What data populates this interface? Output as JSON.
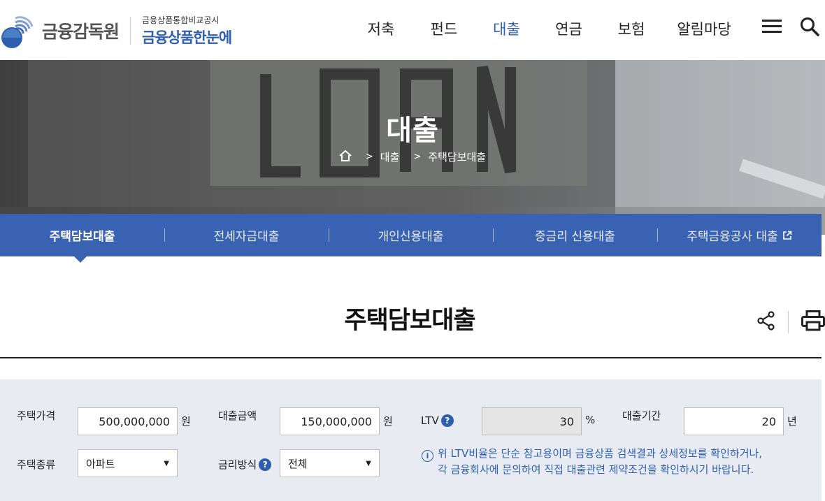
{
  "header": {
    "logo_text": "금융감독원",
    "logo_sub_small": "금융상품통합비교공시",
    "logo_sub_big": "금융상품한눈에",
    "nav": [
      {
        "label": "저축"
      },
      {
        "label": "펀드"
      },
      {
        "label": "대출"
      },
      {
        "label": "연금"
      },
      {
        "label": "보험"
      },
      {
        "label": "알림마당"
      }
    ],
    "active_nav": "대출",
    "icons": [
      "menu-icon",
      "search-icon"
    ]
  },
  "hero": {
    "title": "대출",
    "breadcrumb": [
      "대출",
      "주택담보대출"
    ]
  },
  "subnav": {
    "tabs": [
      {
        "label": "주택담보대출"
      },
      {
        "label": "전세자금대출"
      },
      {
        "label": "개인신용대출"
      },
      {
        "label": "중금리 신용대출"
      },
      {
        "label": "주택금융공사 대출"
      }
    ],
    "active": "주택담보대출"
  },
  "page": {
    "title": "주택담보대출",
    "actions": [
      "share-icon",
      "print-icon"
    ]
  },
  "form": {
    "house_price": {
      "label": "주택가격",
      "value": "500,000,000",
      "unit": "원"
    },
    "loan_amount": {
      "label": "대출금액",
      "value": "150,000,000",
      "unit": "원"
    },
    "ltv": {
      "label": "LTV",
      "value": "30",
      "unit": "%"
    },
    "loan_term": {
      "label": "대출기간",
      "value": "20",
      "unit": "년"
    },
    "house_type": {
      "label": "주택종류",
      "value": "아파트"
    },
    "rate_type": {
      "label": "금리방식",
      "value": "전체"
    },
    "notice_line1": "위 LTV비율은 단순 참고용이며 금융상품 검색결과 상세정보를 확인하거나,",
    "notice_line2": "각 금융회사에 문의하여 직접 대출관련 제약조건을 확인하시기 바랍니다."
  },
  "colors": {
    "brand": "#2e5fae",
    "subnav_bg": "#3a62b3",
    "form_bg": "#e8ecf2"
  }
}
